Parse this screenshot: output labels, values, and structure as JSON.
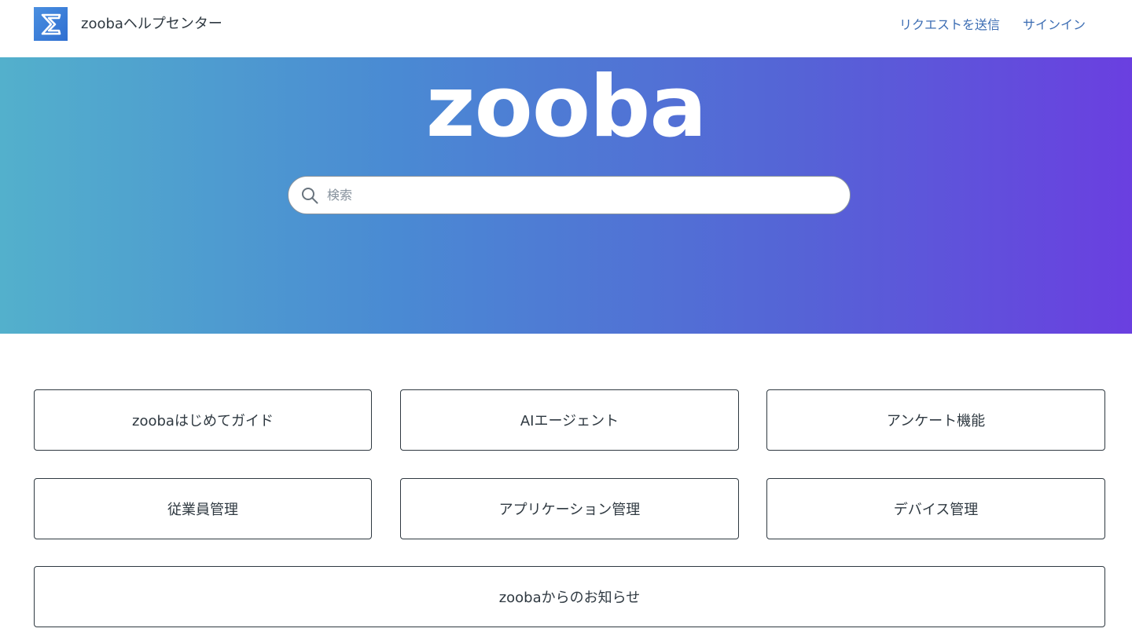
{
  "header": {
    "site_name": "zoobaヘルプセンター",
    "logo_icon": "hourglass-logo-icon",
    "nav": {
      "submit_request": "リクエストを送信",
      "sign_in": "サインイン"
    }
  },
  "hero": {
    "brand": "zooba",
    "search": {
      "placeholder": "検索",
      "value": ""
    },
    "gradient_colors": [
      "#53b0cc",
      "#4a8ad3",
      "#5564d6",
      "#6a3fe0"
    ]
  },
  "categories": [
    "zoobaはじめてガイド",
    "AIエージェント",
    "アンケート機能",
    "従業員管理",
    "アプリケーション管理",
    "デバイス管理",
    "zoobaからのお知らせ"
  ],
  "colors": {
    "link": "#3c6db3",
    "text": "#2f3941",
    "border": "#2f3941"
  }
}
